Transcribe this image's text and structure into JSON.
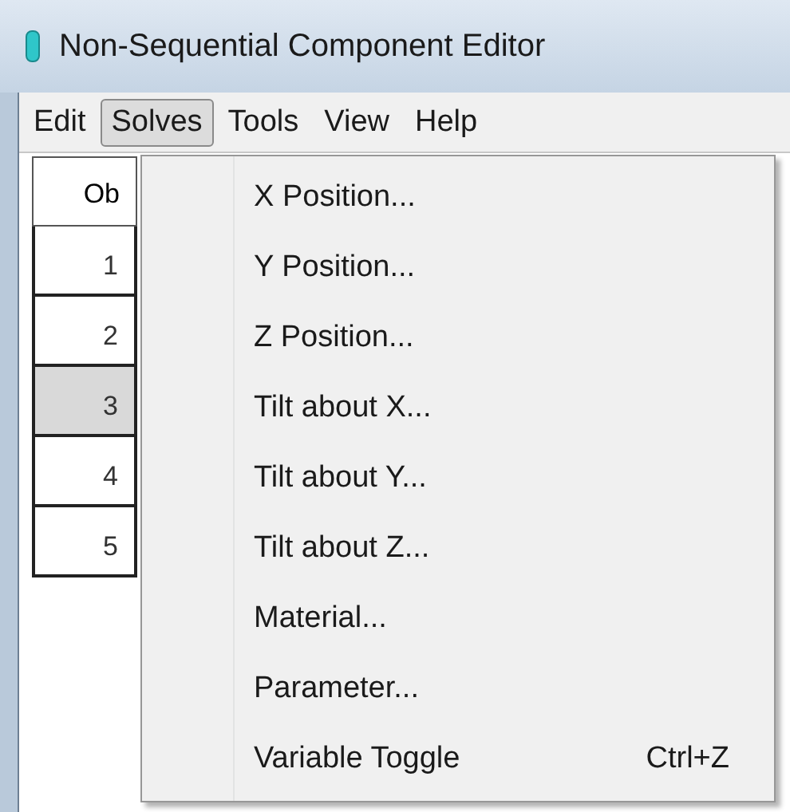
{
  "window": {
    "title": "Non-Sequential Component Editor"
  },
  "menu_bar": [
    {
      "label": "Edit",
      "selected": false
    },
    {
      "label": "Solves",
      "selected": true
    },
    {
      "label": "Tools",
      "selected": false
    },
    {
      "label": "View",
      "selected": false
    },
    {
      "label": "Help",
      "selected": false
    }
  ],
  "table": {
    "column_header": "Ob",
    "rows": [
      {
        "number": "1",
        "selected": false
      },
      {
        "number": "2",
        "selected": false
      },
      {
        "number": "3",
        "selected": true
      },
      {
        "number": "4",
        "selected": false
      },
      {
        "number": "5",
        "selected": false
      }
    ]
  },
  "dropdown_menu": [
    {
      "label": "X Position..."
    },
    {
      "label": "Y Position..."
    },
    {
      "label": "Z Position..."
    },
    {
      "label": "Tilt about X..."
    },
    {
      "label": "Tilt about Y..."
    },
    {
      "label": "Tilt about Z..."
    },
    {
      "label": "Material..."
    },
    {
      "label": "Parameter..."
    },
    {
      "label": "Variable Toggle",
      "shortcut": "Ctrl+Z"
    }
  ]
}
